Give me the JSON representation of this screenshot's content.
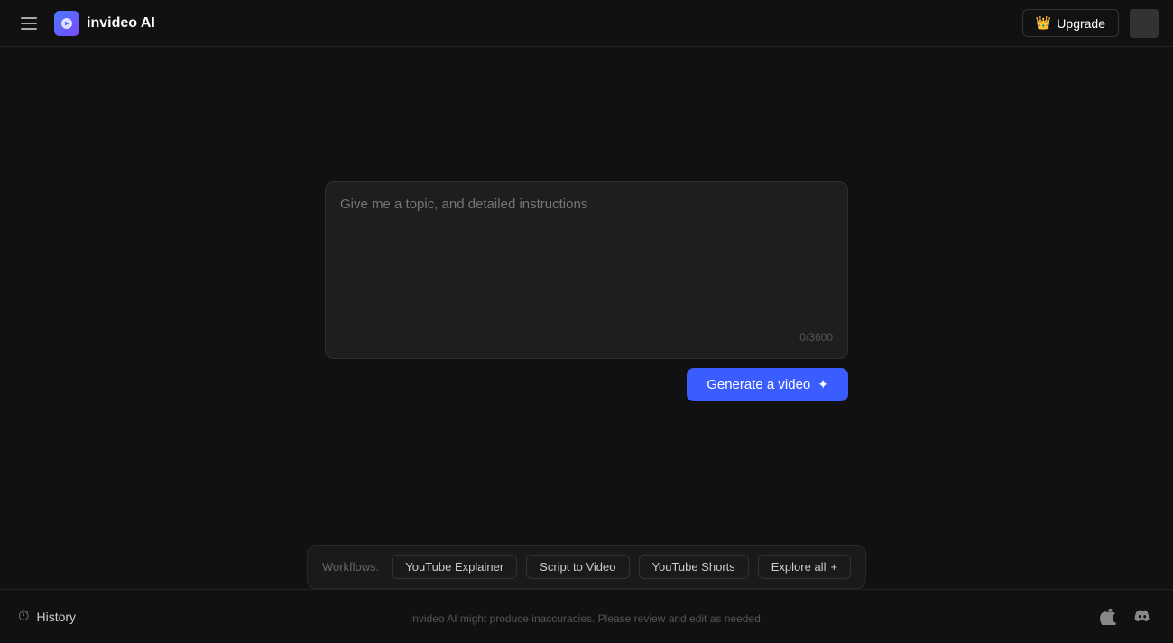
{
  "header": {
    "menu_label": "menu",
    "logo_text": "invideo AI",
    "upgrade_label": "Upgrade",
    "crown_symbol": "👑",
    "avatar_label": "user avatar"
  },
  "main": {
    "prompt_placeholder": "Give me a topic, and detailed instructions",
    "char_count": "0/3600",
    "generate_button_label": "Generate a video",
    "sparkle_symbol": "✦"
  },
  "workflows": {
    "label": "Workflows:",
    "chips": [
      {
        "id": "youtube-explainer",
        "label": "YouTube Explainer"
      },
      {
        "id": "script-to-video",
        "label": "Script to Video"
      },
      {
        "id": "youtube-shorts",
        "label": "YouTube Shorts"
      }
    ],
    "explore_all_label": "Explore all",
    "plus_symbol": "+"
  },
  "footer": {
    "history_label": "History",
    "disclaimer": "Invideo AI might produce inaccuracies. Please review and edit as needed.",
    "apple_icon": "apple",
    "discord_icon": "discord"
  }
}
